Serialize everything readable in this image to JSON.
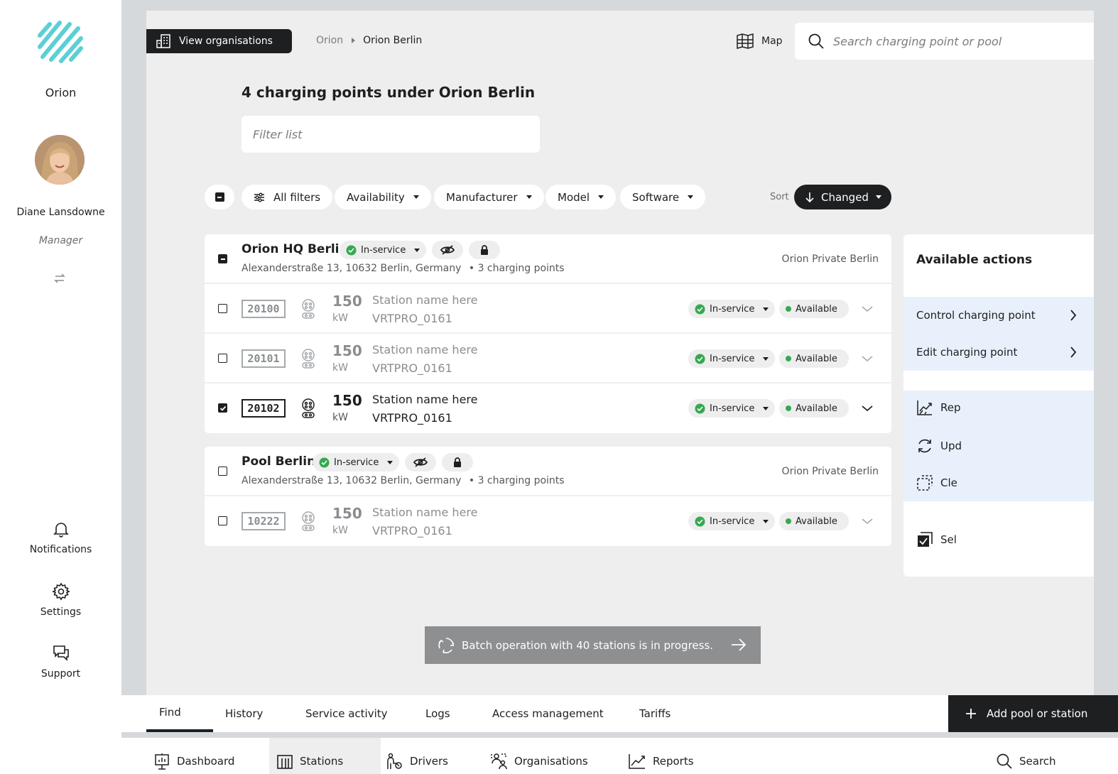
{
  "sidebar": {
    "org_name": "Orion",
    "user_name": "Diane Lansdowne",
    "user_role": "Manager",
    "links": [
      {
        "label": "Notifications",
        "icon": "bell-icon"
      },
      {
        "label": "Settings",
        "icon": "gear-icon"
      },
      {
        "label": "Support",
        "icon": "chat-icon"
      }
    ]
  },
  "header": {
    "view_orgs_label": "View organisations",
    "breadcrumb": [
      "Orion",
      "Orion Berlin"
    ],
    "map_label": "Map",
    "search_placeholder": "Search charging point or pool"
  },
  "main": {
    "title": "4 charging points under Orion Berlin",
    "filter_placeholder": "Filter list",
    "filters": [
      "All filters",
      "Availability",
      "Manufacturer",
      "Model",
      "Software"
    ],
    "sort_label": "Sort",
    "sort_value": "Changed"
  },
  "pools": [
    {
      "name": "Orion HQ Berlin",
      "status": "In-service",
      "address": "Alexanderstraße 13, 10632 Berlin, Germany",
      "count": "• 3 charging points",
      "owner": "Orion Private Berlin",
      "selection": "partial",
      "points": [
        {
          "id": "20100",
          "power": "150",
          "unit": "kW",
          "name": "Station name here",
          "model": "VRTPRO_0161",
          "status": "In-service",
          "availability": "Available",
          "selected": false
        },
        {
          "id": "20101",
          "power": "150",
          "unit": "kW",
          "name": "Station name here",
          "model": "VRTPRO_0161",
          "status": "In-service",
          "availability": "Available",
          "selected": false
        },
        {
          "id": "20102",
          "power": "150",
          "unit": "kW",
          "name": "Station name here",
          "model": "VRTPRO_0161",
          "status": "In-service",
          "availability": "Available",
          "selected": true
        }
      ]
    },
    {
      "name": "Pool Berlin",
      "status": "In-service",
      "address": "Alexanderstraße 13, 10632 Berlin, Germany",
      "count": "• 3 charging points",
      "owner": "Orion Private Berlin",
      "selection": "none",
      "points": [
        {
          "id": "10222",
          "power": "150",
          "unit": "kW",
          "name": "Station name here",
          "model": "VRTPRO_0161",
          "status": "In-service",
          "availability": "Available",
          "selected": false
        }
      ]
    }
  ],
  "actions": {
    "title": "Available actions",
    "links": [
      "Control charging point",
      "Edit charging point"
    ],
    "items": [
      {
        "label": "Rep",
        "icon": "report-icon"
      },
      {
        "label": "Upd",
        "icon": "update-icon"
      },
      {
        "label": "Cle",
        "icon": "clear-selection-icon"
      },
      {
        "label": "Sel",
        "icon": "select-all-icon"
      }
    ]
  },
  "toast": {
    "text": "Batch operation with 40 stations is in progress."
  },
  "tabs": {
    "items": [
      "Find",
      "History",
      "Service activity",
      "Logs",
      "Access management",
      "Tariffs"
    ],
    "active": "Find",
    "add_label": "Add pool or station"
  },
  "bottom_nav": {
    "items": [
      "Dashboard",
      "Stations",
      "Drivers",
      "Organisations",
      "Reports"
    ],
    "active": "Stations",
    "search_label": "Search"
  },
  "colors": {
    "accent": "#1e1f21",
    "brand_teal": "#5ccfd6",
    "status_green": "#36a852",
    "action_bg": "#e8f1fb"
  }
}
